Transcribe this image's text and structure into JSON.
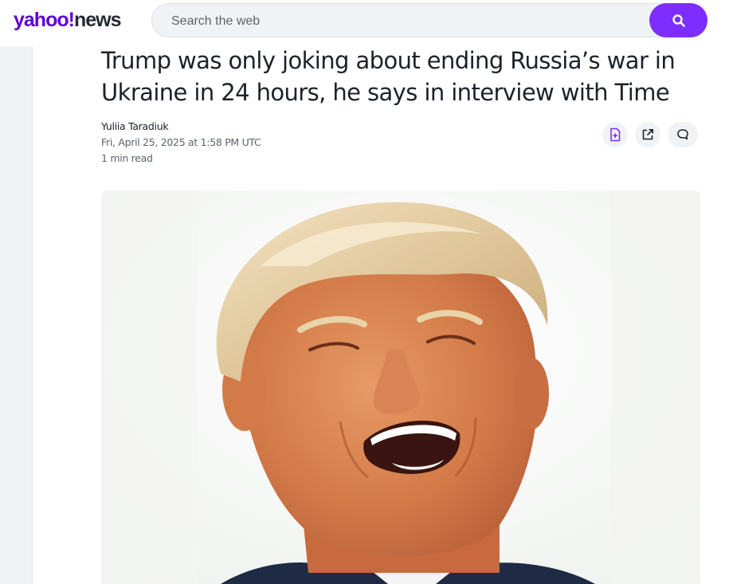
{
  "header": {
    "logo_yahoo": "yahoo!",
    "logo_news": "news",
    "search_placeholder": "Search the web"
  },
  "article": {
    "headline": "Trump was only joking about ending Russia’s war in Ukraine in 24 hours, he says in interview with Time",
    "author": "Yuliia Taradiuk",
    "date": "Fri, April 25, 2025 at 1:58 PM UTC",
    "read_time": "1 min read"
  },
  "actions": [
    "save-icon",
    "share-icon",
    "comment-icon"
  ],
  "colors": {
    "brand_purple": "#6001d2",
    "search_button": "#7d2eff",
    "text": "#1d2228",
    "meta_text": "#5b636a"
  }
}
